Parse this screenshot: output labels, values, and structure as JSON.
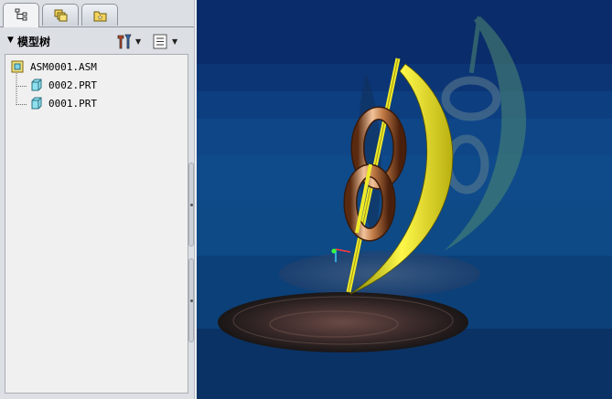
{
  "panel": {
    "tabs": [
      {
        "name": "model-tree-tab",
        "icon": "model-tree-icon"
      },
      {
        "name": "layers-tab",
        "icon": "layers-icon"
      },
      {
        "name": "favorites-tab",
        "icon": "folder-star-icon"
      }
    ],
    "header": {
      "title": "模型树",
      "tools_icon": "tools-icon",
      "settings_icon": "tree-settings-icon"
    },
    "tree": {
      "root": {
        "label": "ASM0001.ASM",
        "icon": "assembly-icon"
      },
      "children": [
        {
          "label": "0002.PRT",
          "icon": "part-icon"
        },
        {
          "label": "0001.PRT",
          "icon": "part-icon"
        }
      ]
    }
  },
  "colors": {
    "viewport_background": "#0c3c7c",
    "part_yellow": "#e8e017",
    "part_copper": "#c9875a",
    "base_dark": "#3a2a2a",
    "reflection_green": "#4a7a6a"
  }
}
